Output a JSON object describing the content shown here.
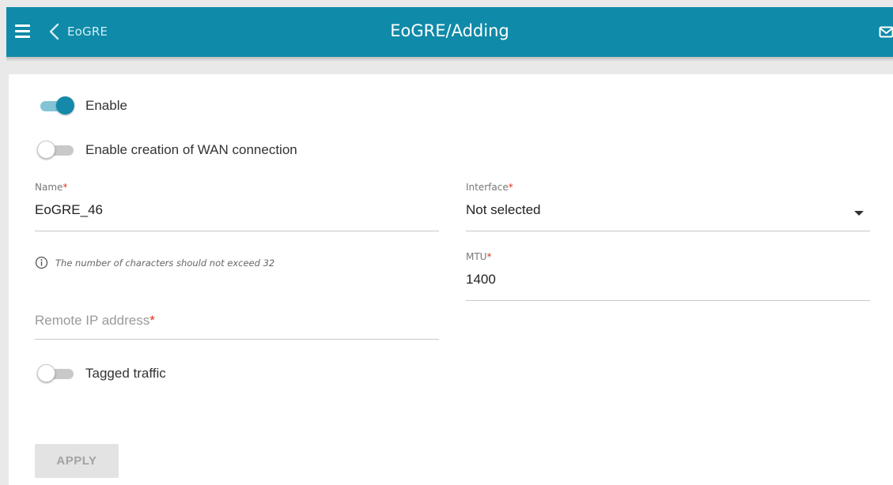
{
  "header": {
    "back_label": "EoGRE",
    "title": "EoGRE/Adding",
    "icons": [
      "menu-icon",
      "chevron-left-icon",
      "mail-icon"
    ],
    "bar_color": "#0f8aa8"
  },
  "toggles": {
    "enable": {
      "label": "Enable",
      "state": "on"
    },
    "wan": {
      "label": "Enable creation of WAN connection",
      "state": "off"
    },
    "tagged": {
      "label": "Tagged traffic",
      "state": "off"
    }
  },
  "form": {
    "name": {
      "label": "Name",
      "value": "EoGRE_46",
      "required_mark": "*"
    },
    "name_hint": "The number of characters should not exceed 32",
    "interface": {
      "label": "Interface",
      "value": "Not selected",
      "required_mark": "*"
    },
    "mtu": {
      "label": "MTU",
      "value": "1400",
      "required_mark": "*"
    },
    "remote_ip": {
      "placeholder": "Remote IP address",
      "value": "",
      "required_mark": "*"
    }
  },
  "actions": {
    "apply_label": "APPLY"
  },
  "colors": {
    "accent": "#1489aa",
    "required": "#e0341b"
  }
}
